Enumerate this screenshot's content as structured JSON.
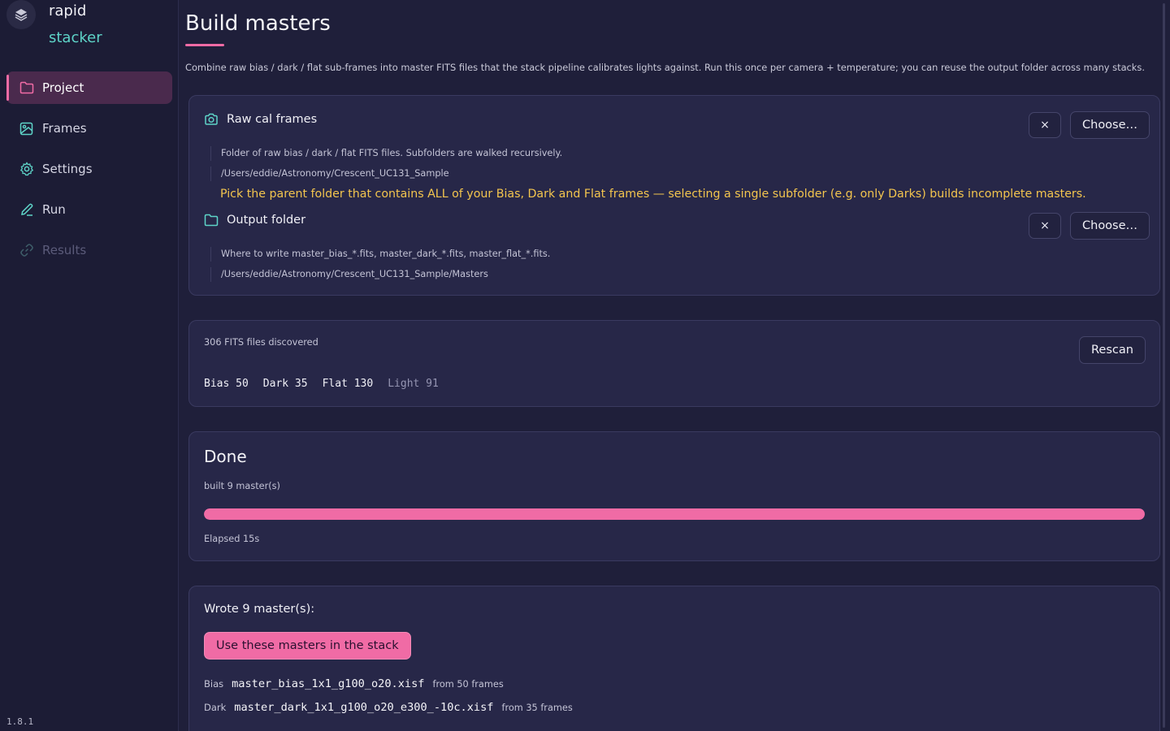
{
  "app": {
    "name_line1": "rapid",
    "name_line2": "stacker",
    "version": "1.8.1"
  },
  "nav": {
    "items": [
      {
        "label": "Project",
        "icon": "folder-icon",
        "state": "active"
      },
      {
        "label": "Frames",
        "icon": "image-icon",
        "state": "normal"
      },
      {
        "label": "Settings",
        "icon": "gear-icon",
        "state": "normal"
      },
      {
        "label": "Run",
        "icon": "pen-icon",
        "state": "normal"
      },
      {
        "label": "Results",
        "icon": "link-icon",
        "state": "disabled"
      }
    ]
  },
  "page": {
    "title": "Build masters",
    "intro": "Combine raw bias / dark / flat sub-frames into master FITS files that the stack pipeline calibrates lights against. Run this once per camera + temperature; you can reuse the output folder across many stacks."
  },
  "inputs": {
    "raw": {
      "label": "Raw cal frames",
      "clear_label": "×",
      "choose_label": "Choose…",
      "hint": "Folder of raw bias / dark / flat FITS files. Subfolders are walked recursively.",
      "path": "/Users/eddie/Astronomy/Crescent_UC131_Sample",
      "warning": "Pick the parent folder that contains ALL of your Bias, Dark and Flat frames — selecting a single subfolder (e.g. only Darks) builds incomplete masters."
    },
    "output": {
      "label": "Output folder",
      "clear_label": "×",
      "choose_label": "Choose…",
      "hint": "Where to write master_bias_*.fits, master_dark_*.fits, master_flat_*.fits.",
      "path": "/Users/eddie/Astronomy/Crescent_UC131_Sample/Masters"
    }
  },
  "discovery": {
    "count_text": "306 FITS files discovered",
    "rescan_label": "Rescan",
    "stats": [
      {
        "text": "Bias 50",
        "muted": false
      },
      {
        "text": "Dark 35",
        "muted": false
      },
      {
        "text": "Flat 130",
        "muted": false
      },
      {
        "text": "Light 91",
        "muted": true
      }
    ]
  },
  "status": {
    "title": "Done",
    "subtitle": "built 9 master(s)",
    "progress": 1.0,
    "elapsed": "Elapsed 15s",
    "accent": "#f06ba5"
  },
  "result": {
    "wrote": "Wrote 9 master(s):",
    "use_label": "Use these masters in the stack",
    "masters": [
      {
        "kind": "Bias",
        "file": "master_bias_1x1_g100_o20.xisf",
        "from": "from 50 frames"
      },
      {
        "kind": "Dark",
        "file": "master_dark_1x1_g100_o20_e300_-10c.xisf",
        "from": "from 35 frames"
      }
    ]
  }
}
